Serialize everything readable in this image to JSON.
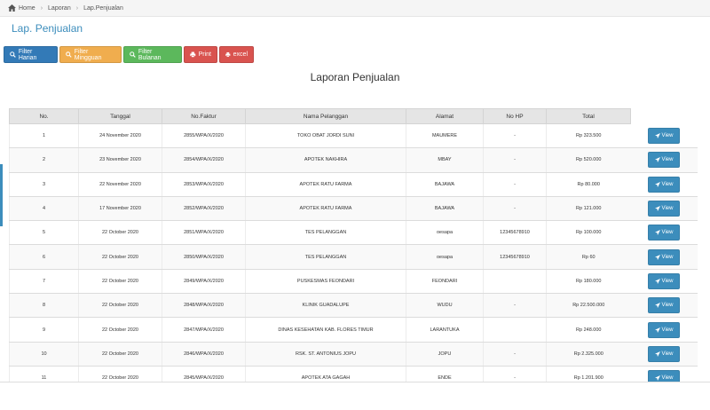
{
  "breadcrumb": {
    "home": "Home",
    "laporan": "Laporan",
    "current": "Lap.Penjualan"
  },
  "page": {
    "title": "Lap. Penjualan",
    "report_title": "Laporan Penjualan"
  },
  "toolbar": {
    "filter_harian": "Filter Harian",
    "filter_mingguan": "Filter Mingguan",
    "filter_bulanan": "Filter Bulanan",
    "print": "Print",
    "excel": "excel"
  },
  "table": {
    "headers": [
      "No.",
      "Tanggal",
      "No.Faktur",
      "Nama Pelanggan",
      "Alamat",
      "No HP",
      "Total"
    ],
    "view_label": "View",
    "rows": [
      [
        "1",
        "24 November 2020",
        "2855/WPA/X/2020",
        "TOKO OBAT JORDI SUNI",
        "MAUMERE",
        "-",
        "Rp 323.500"
      ],
      [
        "2",
        "23 November 2020",
        "2854/WPA/X/2020",
        "APOTEK NAKHIRA",
        "MBAY",
        "-",
        "Rp 520.000"
      ],
      [
        "3",
        "22 November 2020",
        "2853/WPA/X/2020",
        "APOTEK RATU FARMA",
        "BAJAWA",
        "-",
        "Rp 80.000"
      ],
      [
        "4",
        "17 November 2020",
        "2852/WPA/X/2020",
        "APOTEK RATU FARMA",
        "BAJAWA",
        "-",
        "Rp 121.000"
      ],
      [
        "5",
        "22 October 2020",
        "2851/WPA/X/2020",
        "TES PELANGGAN",
        "oesapa",
        "12345678910",
        "Rp 100.000"
      ],
      [
        "6",
        "22 October 2020",
        "2850/WPA/X/2020",
        "TES PELANGGAN",
        "oesapa",
        "12345678910",
        "Rp 60"
      ],
      [
        "7",
        "22 October 2020",
        "2849/WPA/X/2020",
        "PUSKESMAS FEONDARI",
        "FEONDARI",
        "",
        "Rp 180.000"
      ],
      [
        "8",
        "22 October 2020",
        "2848/WPA/X/2020",
        "KLINIK GUADALUPE",
        "WUDU",
        "-",
        "Rp 22.500.000"
      ],
      [
        "9",
        "22 October 2020",
        "2847/WPA/X/2020",
        "DINAS KESEHATAN KAB. FLORES TIMUR",
        "LARANTUKA",
        "",
        "Rp 248.000"
      ],
      [
        "10",
        "22 October 2020",
        "2846/WPA/X/2020",
        "RSK. ST. ANTONIUS JOPU",
        "JOPU",
        "-",
        "Rp 2.325.000"
      ],
      [
        "11",
        "22 October 2020",
        "2845/WPA/X/2020",
        "APOTEK ATA GAGAH",
        "ENDE",
        "-",
        "Rp 1.201.900"
      ]
    ]
  },
  "colors": {
    "primary": "#337ab7",
    "warning": "#f0ad4e",
    "success": "#5cb85c",
    "danger": "#d9534f",
    "view": "#3c8dbc"
  }
}
